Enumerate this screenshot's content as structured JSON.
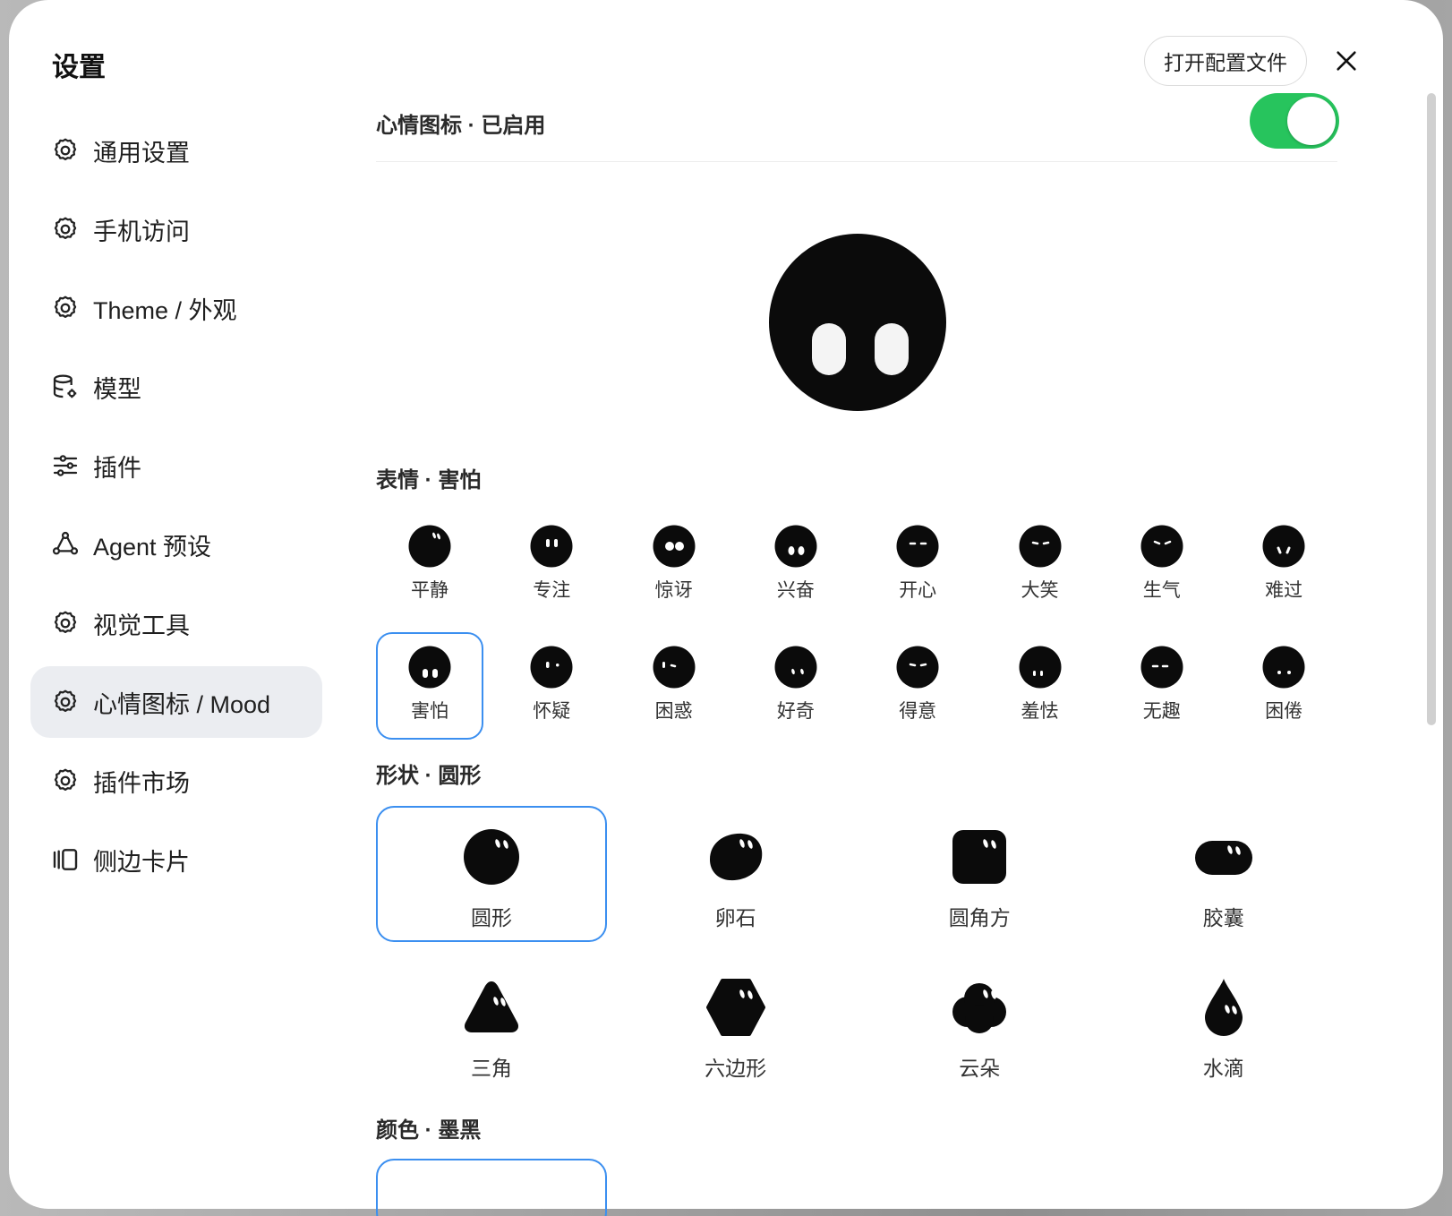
{
  "modal": {
    "title": "设置"
  },
  "sidebar": {
    "items": [
      {
        "label": "通用设置",
        "icon": "gear-icon"
      },
      {
        "label": "手机访问",
        "icon": "gear-icon"
      },
      {
        "label": "Theme / 外观",
        "icon": "gear-icon"
      },
      {
        "label": "模型",
        "icon": "database-gear-icon"
      },
      {
        "label": "插件",
        "icon": "sliders-icon"
      },
      {
        "label": "Agent 预设",
        "icon": "agent-network-icon"
      },
      {
        "label": "视觉工具",
        "icon": "gear-icon"
      },
      {
        "label": "心情图标 / Mood",
        "icon": "gear-icon",
        "active": true
      },
      {
        "label": "插件市场",
        "icon": "gear-icon"
      },
      {
        "label": "侧边卡片",
        "icon": "side-card-icon"
      }
    ]
  },
  "header": {
    "open_config_label": "打开配置文件",
    "close_icon": "close-icon"
  },
  "mood": {
    "enable_title": "心情图标 · 已启用",
    "enabled": true,
    "preview_expression": "害怕",
    "expression_title": "表情 · 害怕",
    "expressions": [
      "平静",
      "专注",
      "惊讶",
      "兴奋",
      "开心",
      "大笑",
      "生气",
      "难过",
      "害怕",
      "怀疑",
      "困惑",
      "好奇",
      "得意",
      "羞怯",
      "无趣",
      "困倦"
    ],
    "selected_expression": "害怕",
    "shape_title": "形状 · 圆形",
    "shapes": [
      "圆形",
      "卵石",
      "圆角方",
      "胶囊",
      "三角",
      "六边形",
      "云朵",
      "水滴"
    ],
    "selected_shape": "圆形",
    "color_title": "颜色 · 墨黑",
    "accent_color": "#3b8ff0",
    "toggle_color": "#27c45d"
  }
}
